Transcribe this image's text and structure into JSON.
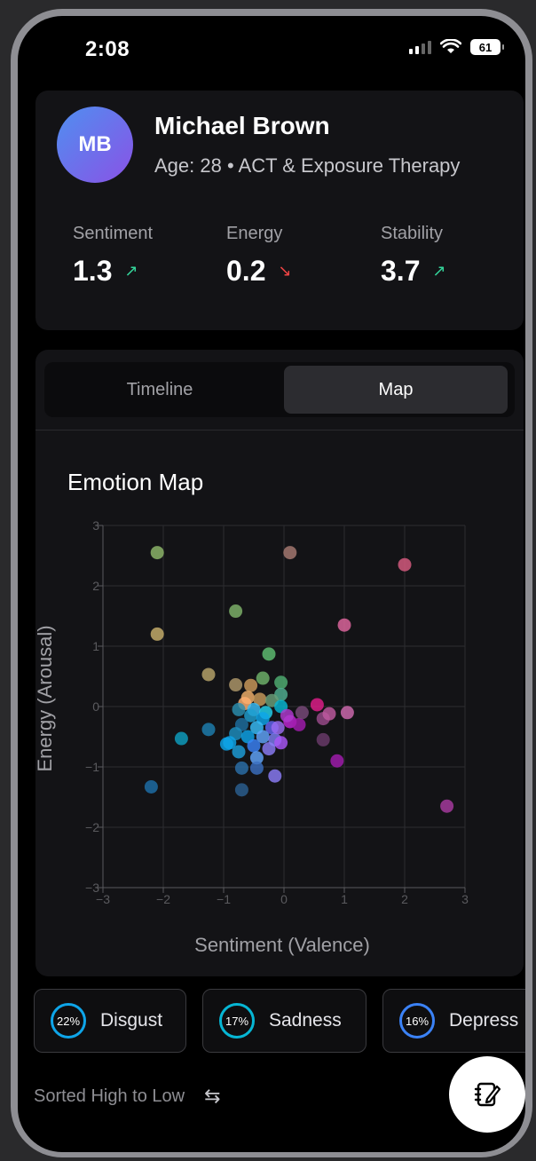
{
  "status_bar": {
    "time": "2:08",
    "battery": "61"
  },
  "profile": {
    "initials": "MB",
    "name": "Michael Brown",
    "meta": "Age: 28 • ACT & Exposure Therapy",
    "metrics": [
      {
        "label": "Sentiment",
        "value": "1.3",
        "trend": "up",
        "arrow": "↗"
      },
      {
        "label": "Energy",
        "value": "0.2",
        "trend": "down",
        "arrow": "↘"
      },
      {
        "label": "Stability",
        "value": "3.7",
        "trend": "up",
        "arrow": "↗"
      }
    ]
  },
  "tabs": [
    {
      "label": "Timeline",
      "active": false
    },
    {
      "label": "Map",
      "active": true
    }
  ],
  "chart_title": "Emotion Map",
  "chart_data": {
    "type": "scatter",
    "title": "Emotion Map",
    "xlabel": "Sentiment (Valence)",
    "ylabel": "Energy (Arousal)",
    "xlim": [
      -3,
      3
    ],
    "ylim": [
      -3,
      3
    ],
    "x_ticks": [
      "−3",
      "−2",
      "−1",
      "0",
      "1",
      "2",
      "3"
    ],
    "y_ticks": [
      "3",
      "2",
      "1",
      "0",
      "−1",
      "−2",
      "−3"
    ],
    "grid": true,
    "points": [
      {
        "x": -2.1,
        "y": 2.55,
        "color": "#8fb86a"
      },
      {
        "x": 0.1,
        "y": 2.55,
        "color": "#a77a72"
      },
      {
        "x": 2.0,
        "y": 2.35,
        "color": "#d95c80"
      },
      {
        "x": -0.8,
        "y": 1.58,
        "color": "#7fb36a"
      },
      {
        "x": -2.1,
        "y": 1.2,
        "color": "#c8b06b"
      },
      {
        "x": 1.0,
        "y": 1.35,
        "color": "#e0679f"
      },
      {
        "x": -0.25,
        "y": 0.87,
        "color": "#5fbf72"
      },
      {
        "x": -1.25,
        "y": 0.53,
        "color": "#b8a56a"
      },
      {
        "x": -0.8,
        "y": 0.36,
        "color": "#b0996a"
      },
      {
        "x": -0.55,
        "y": 0.35,
        "color": "#cc9a5a"
      },
      {
        "x": -0.35,
        "y": 0.47,
        "color": "#6fb36a"
      },
      {
        "x": -0.05,
        "y": 0.4,
        "color": "#4fae72"
      },
      {
        "x": -0.05,
        "y": 0.2,
        "color": "#4fae90"
      },
      {
        "x": -0.6,
        "y": 0.15,
        "color": "#f0b06a"
      },
      {
        "x": -0.4,
        "y": 0.12,
        "color": "#c89a5a"
      },
      {
        "x": -0.2,
        "y": 0.1,
        "color": "#6aa07a"
      },
      {
        "x": -0.65,
        "y": 0.05,
        "color": "#ffb070"
      },
      {
        "x": -0.5,
        "y": -0.05,
        "color": "#38bdf8"
      },
      {
        "x": -0.3,
        "y": -0.1,
        "color": "#22d3ee"
      },
      {
        "x": -0.05,
        "y": 0.0,
        "color": "#06b6d4"
      },
      {
        "x": -0.75,
        "y": -0.05,
        "color": "#2b8fb0"
      },
      {
        "x": -0.55,
        "y": -0.15,
        "color": "#1e9fd0"
      },
      {
        "x": -0.35,
        "y": -0.2,
        "color": "#0ea5e9"
      },
      {
        "x": -0.7,
        "y": -0.3,
        "color": "#1d6fa0"
      },
      {
        "x": -0.45,
        "y": -0.35,
        "color": "#38bdf8"
      },
      {
        "x": -0.2,
        "y": -0.35,
        "color": "#6366f1"
      },
      {
        "x": -0.8,
        "y": -0.45,
        "color": "#1d8fc0"
      },
      {
        "x": -0.6,
        "y": -0.5,
        "color": "#0ea5e9"
      },
      {
        "x": -0.35,
        "y": -0.5,
        "color": "#60a5fa"
      },
      {
        "x": -0.15,
        "y": -0.55,
        "color": "#7c7cf0"
      },
      {
        "x": -0.9,
        "y": -0.6,
        "color": "#0ea5e9"
      },
      {
        "x": -0.5,
        "y": -0.65,
        "color": "#3b82f6"
      },
      {
        "x": -0.25,
        "y": -0.7,
        "color": "#8b7cf6"
      },
      {
        "x": -0.75,
        "y": -0.75,
        "color": "#1d9fd9"
      },
      {
        "x": -0.45,
        "y": -0.85,
        "color": "#60a5fa"
      },
      {
        "x": -0.05,
        "y": -0.6,
        "color": "#a855f7"
      },
      {
        "x": -0.1,
        "y": -0.35,
        "color": "#9b6cf0"
      },
      {
        "x": 0.1,
        "y": -0.25,
        "color": "#c026d3"
      },
      {
        "x": 0.25,
        "y": -0.3,
        "color": "#a21caf"
      },
      {
        "x": 0.05,
        "y": -0.15,
        "color": "#b03ad0"
      },
      {
        "x": 0.3,
        "y": -0.1,
        "color": "#7a4a7a"
      },
      {
        "x": 0.55,
        "y": 0.03,
        "color": "#e11d8a"
      },
      {
        "x": 0.65,
        "y": -0.2,
        "color": "#9a4a8a"
      },
      {
        "x": 0.75,
        "y": -0.12,
        "color": "#c05aa0"
      },
      {
        "x": 1.05,
        "y": -0.1,
        "color": "#d06ab0"
      },
      {
        "x": 0.65,
        "y": -0.55,
        "color": "#6a3a6a"
      },
      {
        "x": 0.88,
        "y": -0.9,
        "color": "#a21caf"
      },
      {
        "x": -1.7,
        "y": -0.53,
        "color": "#0e9fc0"
      },
      {
        "x": -1.25,
        "y": -0.38,
        "color": "#1d7fb0"
      },
      {
        "x": -0.95,
        "y": -0.62,
        "color": "#0ea5e9"
      },
      {
        "x": -0.7,
        "y": -1.02,
        "color": "#2b6fa8"
      },
      {
        "x": -0.45,
        "y": -1.02,
        "color": "#3b6fc0"
      },
      {
        "x": -0.15,
        "y": -1.15,
        "color": "#8b7cf6"
      },
      {
        "x": -0.7,
        "y": -1.38,
        "color": "#2b5f90"
      },
      {
        "x": -2.2,
        "y": -1.33,
        "color": "#1d6fa8"
      },
      {
        "x": 2.7,
        "y": -1.65,
        "color": "#a83aa0"
      }
    ]
  },
  "emotion_chips": [
    {
      "percent": "22%",
      "label": "Disgust",
      "ring_color": "#0ea5e9"
    },
    {
      "percent": "17%",
      "label": "Sadness",
      "ring_color": "#06b6d4"
    },
    {
      "percent": "16%",
      "label": "Depress",
      "ring_color": "#3b82f6"
    }
  ],
  "sort_label": "Sorted High to Low"
}
